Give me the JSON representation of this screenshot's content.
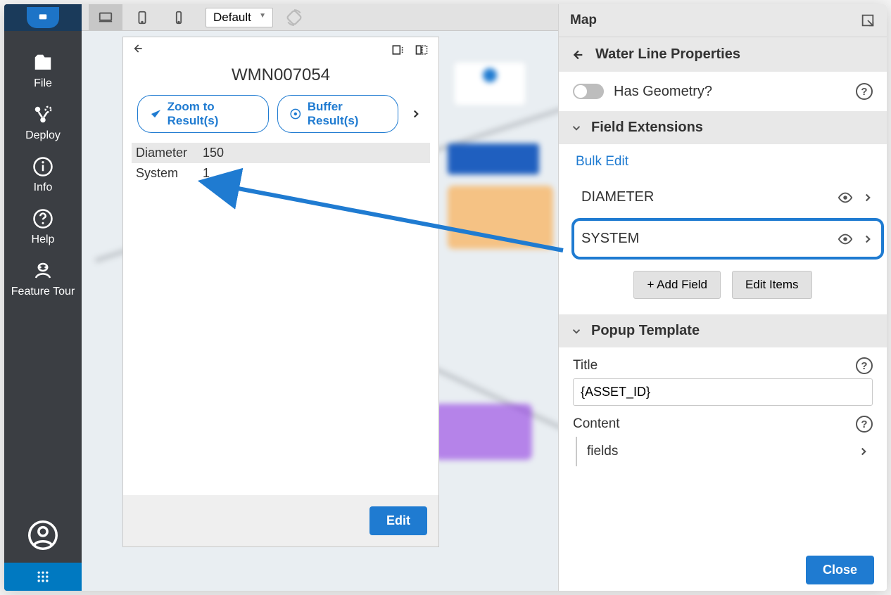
{
  "sidebar": {
    "items": [
      {
        "id": "file",
        "label": "File"
      },
      {
        "id": "deploy",
        "label": "Deploy"
      },
      {
        "id": "info",
        "label": "Info"
      },
      {
        "id": "help",
        "label": "Help"
      },
      {
        "id": "feature-tour",
        "label": "Feature Tour"
      }
    ]
  },
  "deviceBar": {
    "themeSelected": "Default"
  },
  "popup": {
    "title": "WMN007054",
    "zoom_label": "Zoom to Result(s)",
    "buffer_label": "Buffer Result(s)",
    "attributes": [
      {
        "key": "Diameter",
        "value": "150"
      },
      {
        "key": "System",
        "value": "1"
      }
    ],
    "edit_label": "Edit"
  },
  "config": {
    "header": "Map",
    "subheader": "Water Line Properties",
    "has_geometry_label": "Has Geometry?",
    "field_extensions_header": "Field Extensions",
    "bulk_edit_label": "Bulk Edit",
    "fields": [
      {
        "name": "DIAMETER"
      },
      {
        "name": "SYSTEM"
      }
    ],
    "add_field_label": "+ Add Field",
    "edit_items_label": "Edit Items",
    "popup_template_header": "Popup Template",
    "title_label": "Title",
    "title_value": "{ASSET_ID}",
    "content_label": "Content",
    "fields_label": "fields",
    "close_label": "Close"
  }
}
